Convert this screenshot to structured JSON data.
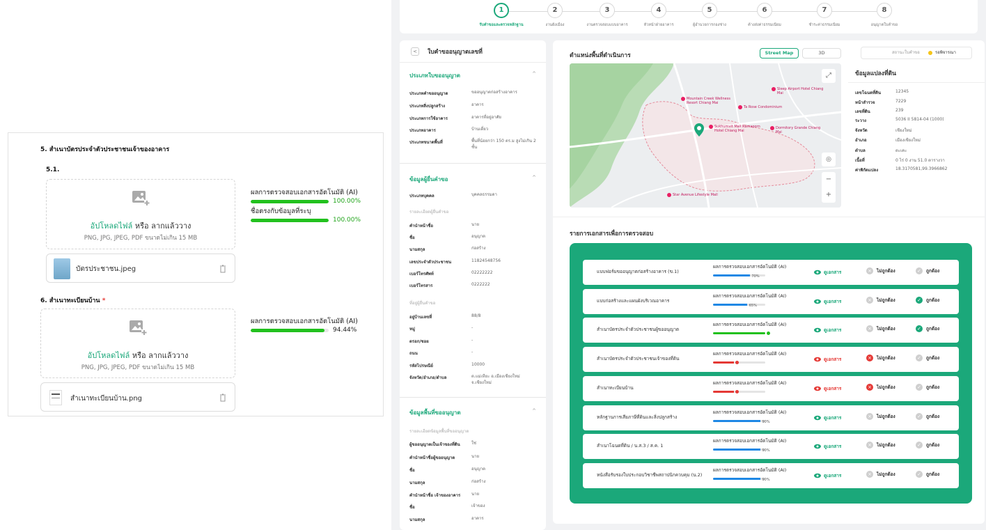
{
  "left": {
    "section5_title": "5. สำเนาบัตรประจำตัวประชาชนเจ้าของอาคาร",
    "section5_sub": "5.1.",
    "section6_title": "6. สำเนาทะเบียนบ้าน",
    "section6_required": "*",
    "upload_link": "อัปโหลดไฟล์",
    "upload_rest": "หรือ ลากแล้ววาง",
    "upload_hint": "PNG, JPG, JPEG, PDF ขนาดไม่เกิน 15 MB",
    "file1": "บัตรประชาชน.jpeg",
    "file2": "สำเนาทะเบียนบ้าน.png",
    "ai_label": "ผลการตรวจสอบเอกสารอัตโนมัติ (AI)",
    "match_label": "ชื่อตรงกับข้อมูลที่ระบุ",
    "ai1_pct": "100.00%",
    "ai1_value": 100,
    "match_pct": "100.00%",
    "match_value": 100,
    "ai2_pct": "94.44%",
    "ai2_value": 94.44
  },
  "steps": [
    {
      "num": "1",
      "label": "รับคำขอและตรวจหลักฐาน"
    },
    {
      "num": "2",
      "label": "งานผังเมือง"
    },
    {
      "num": "3",
      "label": "งานตรวจสอบแบบอาคาร"
    },
    {
      "num": "4",
      "label": "หัวหน้าฝ่ายอาคาร"
    },
    {
      "num": "5",
      "label": "ผู้อำนวยการกองช่าง"
    },
    {
      "num": "6",
      "label": "ค้างส่งค่าธรรมเนียม"
    },
    {
      "num": "7",
      "label": "ชำระค่าธรรมเนียม"
    },
    {
      "num": "8",
      "label": "อนุญาตใบคำขอ"
    }
  ],
  "info": {
    "title": "ใบคำขออนุญาตเลขที่",
    "back": "<",
    "chevron": "^",
    "g1": "ประเภทใบขออนุญาต",
    "g1_rows": [
      {
        "k": "ประเภทคำขออนุญาต",
        "v": "ขออนุญาตก่อสร้างอาคาร"
      },
      {
        "k": "ประเภทสิ่งปลูกสร้าง",
        "v": "อาคาร"
      },
      {
        "k": "ประเภทการใช้อาคาร",
        "v": "อาคารที่อยู่อาศัย"
      },
      {
        "k": "ประเภทอาคาร",
        "v": "บ้านเดี่ยว"
      },
      {
        "k": "ประเภทขนาดพื้นที่",
        "v": "พื้นที่น้อยกว่า 150 ตร.ม สูงไม่เกิน 2 ชั้น"
      }
    ],
    "g2": "ข้อมูลผู้ยื่นคำขอ",
    "g2_type_k": "ประเภทบุคคล",
    "g2_type_v": "บุคคลธรรมดา",
    "g2_note": "รายละเอียดผู้ยื่นคำขอ",
    "g2_rows": [
      {
        "k": "คำนำหน้าชื่อ",
        "v": "นาย"
      },
      {
        "k": "ชื่อ",
        "v": "อนุญาต"
      },
      {
        "k": "นามสกุล",
        "v": "ก่อสร้าง"
      },
      {
        "k": "เลขประจำตัวประชาชน",
        "v": "11824548756"
      },
      {
        "k": "เบอร์โทรศัพท์",
        "v": "02222222"
      },
      {
        "k": "เบอร์โทรสาร",
        "v": "0222222"
      }
    ],
    "g2_note2": "ที่อยู่ผู้ยื่นคำขอ",
    "g2_addr": [
      {
        "k": "อยู่บ้านเลขที่",
        "v": "88/8"
      },
      {
        "k": "หมู่",
        "v": "-"
      },
      {
        "k": "ตรอก/ซอย",
        "v": "-"
      },
      {
        "k": "ถนน",
        "v": "-"
      },
      {
        "k": "รหัสไปรษณีย์",
        "v": "10000"
      },
      {
        "k": "จังหวัด/อำเภอ/ตำบล",
        "v": "ต.แม่เหียะ อ.เมืองเชียงใหม่ จ.เชียงใหม่"
      }
    ],
    "g3": "ข้อมูลพื้นที่ขออนุญาต",
    "g3_note": "รายละเอียดข้อมูลพื้นที่ขออนุญาต",
    "g3_rows": [
      {
        "k": "ผู้ขออนุญาตเป็นเจ้าของที่ดิน",
        "v": "ใช่"
      },
      {
        "k": "คำนำหน้าชื่อผู้ขออนุญาต",
        "v": "นาย"
      },
      {
        "k": "ชื่อ",
        "v": "อนุญาต"
      },
      {
        "k": "นามสกุล",
        "v": "ก่อสร้าง"
      },
      {
        "k": "คำนำหน้าชื่อ เจ้าของอาคาร",
        "v": "นาย"
      },
      {
        "k": "ชื่อ",
        "v": "เจ้าของ"
      },
      {
        "k": "นามสกุล",
        "v": "อาคาร"
      }
    ]
  },
  "map": {
    "title": "ตำแหน่งพื้นที่ดำเนินการ",
    "tab_street": "Street Map",
    "tab_3d": "3D",
    "labels": [
      "Sleep Airport Hotel Chiang Mai",
      "Mountain Creek Wellness Resort Chiang Mai",
      "Ta Rose Condominium",
      "Sukhumvit Mali Ramaporn Hotel Chiang Mai",
      "Dormitory Grande Chiang Mai",
      "Star Avenue Lifestyle Mall"
    ],
    "zoom_in": "+",
    "zoom_out": "−",
    "expand": "⤢",
    "locate": "◎"
  },
  "status": {
    "label": "สถานะใบคำขอ",
    "value": "รอพิจารณา"
  },
  "parcel": {
    "title": "ข้อมูลแปลงที่ดิน",
    "rows": [
      {
        "k": "เลขโฉนดที่ดิน",
        "v": "12345"
      },
      {
        "k": "หน้าสำรวจ",
        "v": "7229"
      },
      {
        "k": "เลขที่ดิน",
        "v": "239"
      },
      {
        "k": "ระวาง",
        "v": "5036 II 5814-04 (1000)"
      },
      {
        "k": "จังหวัด",
        "v": "เชียงใหม่"
      },
      {
        "k": "อำเภอ",
        "v": "เมืองเชียงใหม่"
      },
      {
        "k": "ตำบล",
        "v": "ตะเคะ"
      },
      {
        "k": "เนื้อที่",
        "v": "0 ไร่ 0 งาน 51.0 ตารางวา"
      },
      {
        "k": "ค่าพิกัดแปลง",
        "v": "18.3170581,99.3966862"
      }
    ]
  },
  "docs": {
    "title": "รายการเอกสารเพื่อการตรวจสอบ",
    "ai_label": "ผลการตรวจสอบเอกสารอัตโนมัติ (AI)",
    "view": "ดูเอกสาร",
    "reject": "ไม่ถูกต้อง",
    "accept": "ถูกต้อง",
    "items": [
      {
        "name": "แบบฟอร์มขออนุญาตก่อสร้างอาคาร (ข.1)",
        "pct": "70%",
        "value": 70,
        "state": "pending"
      },
      {
        "name": "แบบก่อสร้างและแผนผังบริเวณอาคาร",
        "pct": "65%",
        "value": 65,
        "state": "ok"
      },
      {
        "name": "สำเนาบัตรประจำตัวประชาชนผู้ขออนุญาต",
        "pct": "",
        "value": 100,
        "state": "ok-green"
      },
      {
        "name": "สำเนาบัตรประจำตัวประชาชนเจ้าของที่ดิน",
        "pct": "",
        "value": 40,
        "state": "reject"
      },
      {
        "name": "สำเนาทะเบียนบ้าน",
        "pct": "",
        "value": 40,
        "state": "reject"
      },
      {
        "name": "หลักฐานการเสียภาษีที่ดินและสิ่งปลูกสร้าง",
        "pct": "90%",
        "value": 90,
        "state": "pending"
      },
      {
        "name": "สำเนาโฉนดที่ดิน / น.ส.3 / ส.ค. 1",
        "pct": "90%",
        "value": 90,
        "state": "pending"
      },
      {
        "name": "หนังสือรับรองใบประกอบวิชาชีพสถาปนิกควบคุม (น.2)",
        "pct": "90%",
        "value": 90,
        "state": "pending"
      }
    ]
  },
  "colors": {
    "brand": "#1ba87a",
    "green": "#22c11e",
    "blue": "#1e88e5",
    "red": "#e53935"
  }
}
